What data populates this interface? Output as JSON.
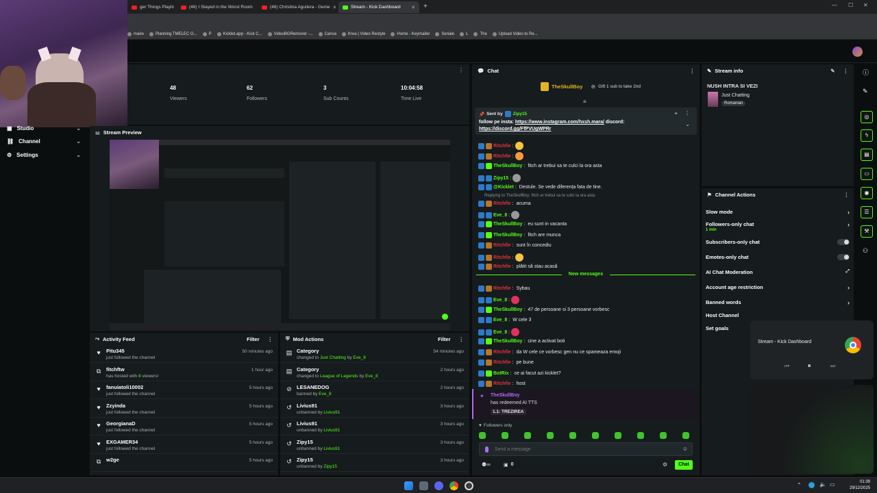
{
  "browser": {
    "tabs": [
      {
        "label": "ger Things Playlist |",
        "kind": "yt",
        "active": false
      },
      {
        "label": "(46) I Stayed in the Worst Room",
        "kind": "yt",
        "active": false
      },
      {
        "label": "(46) Christina Aguilera - Genie",
        "kind": "yt",
        "active": false
      },
      {
        "label": "Stream - Kick Dashboard",
        "kind": "kick",
        "active": true
      }
    ],
    "bookmarks": [
      "maire",
      "Planning TMELEC G...",
      "P",
      "Kicklet.app - Kick C...",
      "VideoBGRemover -...",
      "Canva",
      "Krea | Video Restyle",
      "Home - Keymailer",
      "Seriale",
      "L",
      "The",
      "Upload Video to Re..."
    ]
  },
  "stats": [
    {
      "value": "48",
      "label": "Viewers"
    },
    {
      "value": "62",
      "label": "Followers"
    },
    {
      "value": "3",
      "label": "Sub Counts"
    },
    {
      "value": "10:04:58",
      "label": "Time Live"
    }
  ],
  "sidebar": {
    "items": [
      "Studio",
      "Channel",
      "Settings"
    ]
  },
  "preview": {
    "title": "Stream Preview"
  },
  "activity": {
    "title": "Activity Feed",
    "filter": "Filter",
    "rows": [
      {
        "name": "Pitu345",
        "pre": "",
        "hl": "",
        "post": "just followed the channel",
        "time": "50 minutes ago",
        "icon": "heart-icon"
      },
      {
        "name": "fitchftw",
        "pre": "has hosted with ",
        "hl": "8",
        "post": " viewers!",
        "time": "1 hour ago",
        "icon": "host-icon"
      },
      {
        "name": "fanuiatoli10002",
        "pre": "",
        "hl": "",
        "post": "just followed the channel",
        "time": "5 hours ago",
        "icon": "heart-icon"
      },
      {
        "name": "Zzyinda",
        "pre": "",
        "hl": "",
        "post": "just followed the channel",
        "time": "5 hours ago",
        "icon": "heart-icon"
      },
      {
        "name": "GeorgianaD",
        "pre": "",
        "hl": "",
        "post": "just followed the channel",
        "time": "5 hours ago",
        "icon": "heart-icon"
      },
      {
        "name": "EXGAMER34",
        "pre": "",
        "hl": "",
        "post": "just followed the channel",
        "time": "5 hours ago",
        "icon": "heart-icon"
      },
      {
        "name": "w2ge",
        "pre": "",
        "hl": "",
        "post": "",
        "time": "5 hours ago",
        "icon": "host-icon"
      }
    ]
  },
  "mod": {
    "title": "Mod Actions",
    "filter": "Filter",
    "rows": [
      {
        "name": "Category",
        "pre": "changed to ",
        "hl": "Just Chatting",
        "mid": " by ",
        "by": "Eve_8",
        "time": "54 minutes ago",
        "icon": "category-icon"
      },
      {
        "name": "Category",
        "pre": "changed to ",
        "hl": "League of Legends",
        "mid": " by ",
        "by": "Eve_8",
        "time": "2 hours ago",
        "icon": "category-icon"
      },
      {
        "name": "LESANEDOG",
        "pre": "banned by ",
        "hl": "",
        "mid": "",
        "by": "Eve_8",
        "time": "2 hours ago",
        "icon": "ban-icon"
      },
      {
        "name": "Livius91",
        "pre": "unbanned by ",
        "hl": "",
        "mid": "",
        "by": "Livius91",
        "time": "3 hours ago",
        "icon": "unban-icon"
      },
      {
        "name": "Livius91",
        "pre": "unbanned by ",
        "hl": "",
        "mid": "",
        "by": "Livius91",
        "time": "3 hours ago",
        "icon": "unban-icon"
      },
      {
        "name": "Zipy15",
        "pre": "unbanned by ",
        "hl": "",
        "mid": "",
        "by": "Livius91",
        "time": "3 hours ago",
        "icon": "unban-icon"
      },
      {
        "name": "Zipy15",
        "pre": "unbanned by ",
        "hl": "",
        "mid": "",
        "by": "Zipy15",
        "time": "3 hours ago",
        "icon": "unban-icon"
      }
    ]
  },
  "chat": {
    "title": "Chat",
    "top_user": "TheSkullBoy",
    "top_gift": "Gift 1 sub to take 2nd",
    "pinned": {
      "sent_by": "Sent by",
      "user": "Zipy15",
      "text_a": "follow pe insta: ",
      "link_a": "https://www.instagram.com/hxsh.mara/",
      "text_b": " discord: ",
      "link_b": "https://discord.gg/FfPVUgWPRr"
    },
    "messages": [
      {
        "user": "Ritchfie",
        "text": "",
        "color": "red"
      },
      {
        "user": "Ritchfie",
        "text": "",
        "color": "red"
      },
      {
        "user": "TheSkullBoy",
        "text": "fitch ar trebui sa te culci la ora asta",
        "color": "green"
      },
      {
        "user": "Zipy15",
        "text": "",
        "color": "green"
      },
      {
        "user": "@Kicklet",
        "text": "Destule. Se vede diferența fata de tine.",
        "color": "green"
      }
    ],
    "reply_note": "Replying to TheSkullBoy: fitch ar trebui sa te culci la ora asta",
    "messages2": [
      {
        "user": "Ritchfie",
        "text": "acuma",
        "color": "red"
      },
      {
        "user": "Eve_8",
        "text": "",
        "color": "green"
      },
      {
        "user": "TheSkullBoy",
        "text": "eu sunt in vacanta",
        "color": "green"
      },
      {
        "user": "TheSkullBoy",
        "text": "fitch are munca",
        "color": "green"
      },
      {
        "user": "Ritchfie",
        "text": "sunt în concediu",
        "color": "red"
      },
      {
        "user": "Ritchfie",
        "text": "",
        "color": "red"
      },
      {
        "user": "Ritchfie",
        "text": "plătit să stau acasă",
        "color": "red"
      }
    ],
    "new_messages": "New messages",
    "messages3": [
      {
        "user": "Ritchfie",
        "text": "Sybau",
        "color": "red"
      },
      {
        "user": "Eve_8",
        "text": "",
        "color": "green"
      },
      {
        "user": "TheSkullBoy",
        "text": "47 de persoane si 3 persoane vorbesc",
        "color": "green"
      },
      {
        "user": "Eve_8",
        "text": "W cele 3",
        "color": "green"
      },
      {
        "user": "Eve_8",
        "text": "",
        "color": "green"
      },
      {
        "user": "TheSkullBoy",
        "text": "cine a activat boti",
        "color": "green"
      },
      {
        "user": "Ritchfie",
        "text": "da W cele ce vorbesc gen nu ce spameaza emoji",
        "color": "red"
      },
      {
        "user": "Ritchfie",
        "text": "pe bune",
        "color": "red"
      },
      {
        "user": "BotRix",
        "text": "ce ai facut azi kicklet?",
        "color": "green"
      },
      {
        "user": "Ritchfie",
        "text": "host",
        "color": "red"
      }
    ],
    "redeem": {
      "user": "TheSkullBoy",
      "text": "has redeemed AI TTS",
      "reward": "1.1: TREZIREA"
    },
    "followers_only": "Followers only",
    "placeholder": "Send a message",
    "count": "0",
    "send": "Chat"
  },
  "stream_info": {
    "title": "Stream info",
    "stream_title": "NUSH INTRA SI VEZI",
    "category": "Just Chatting",
    "tag": "Romanian"
  },
  "channel_actions": {
    "title": "Channel Actions",
    "items": [
      {
        "label": "Slow mode",
        "ctl": "chev",
        "sub": ""
      },
      {
        "label": "Followers-only chat",
        "ctl": "chev",
        "sub": "1 min"
      },
      {
        "label": "Subscribers-only chat",
        "ctl": "toggle",
        "sub": ""
      },
      {
        "label": "Emotes-only chat",
        "ctl": "toggle",
        "sub": ""
      },
      {
        "label": "AI Chat Moderation",
        "ctl": "ext",
        "sub": ""
      },
      {
        "label": "Account age restriction",
        "ctl": "chev",
        "sub": ""
      },
      {
        "label": "Banned words",
        "ctl": "chev",
        "sub": ""
      },
      {
        "label": "Host Channel",
        "ctl": "",
        "sub": ""
      },
      {
        "label": "Set goals",
        "ctl": "",
        "sub": ""
      }
    ]
  },
  "media": {
    "title": "Stream - Kick Dashboard"
  },
  "clock": {
    "time": "01:39",
    "date": "29/12/2025"
  },
  "colors": {
    "accent": "#53fc18",
    "panel": "#161b1d",
    "bg": "#0b0e0f",
    "danger": "#e0323c"
  }
}
